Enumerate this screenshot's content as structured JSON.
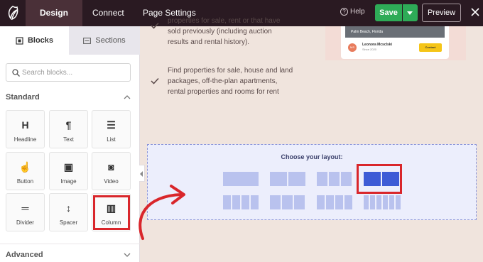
{
  "topbar": {
    "tabs": [
      "Design",
      "Connect",
      "Page Settings"
    ],
    "help": "Help",
    "save": "Save",
    "preview": "Preview"
  },
  "sidebar": {
    "tabs": [
      "Blocks",
      "Sections"
    ],
    "search_placeholder": "Search blocks...",
    "standard_label": "Standard",
    "advanced_label": "Advanced",
    "blocks": [
      {
        "label": "Headline",
        "icon": "H"
      },
      {
        "label": "Text",
        "icon": "¶"
      },
      {
        "label": "List",
        "icon": "☰"
      },
      {
        "label": "Button",
        "icon": "☝"
      },
      {
        "label": "Image",
        "icon": "▣"
      },
      {
        "label": "Video",
        "icon": "◙"
      },
      {
        "label": "Divider",
        "icon": "═"
      },
      {
        "label": "Spacer",
        "icon": "↕"
      },
      {
        "label": "Column",
        "icon": "▥"
      }
    ]
  },
  "canvas": {
    "bullet1": "properties for sale, rent or that have sold previously (including auction results and rental history).",
    "bullet2": "Find properties for sale, house and land packages, off-the-plan apartments, rental properties and rooms for rent",
    "card": {
      "image_text": "Palm Beach, Florida",
      "avatar": "MS",
      "name": "Leonora Mcsclski",
      "since": "Since 2020",
      "contact": "Contact"
    },
    "layout_title": "Choose your layout:"
  },
  "colors": {
    "topbar": "#2a1a22",
    "save": "#2eab57",
    "highlight": "#d9262b",
    "layout_selected": "#3d5bd6",
    "layout_option": "#b9c2ee"
  }
}
